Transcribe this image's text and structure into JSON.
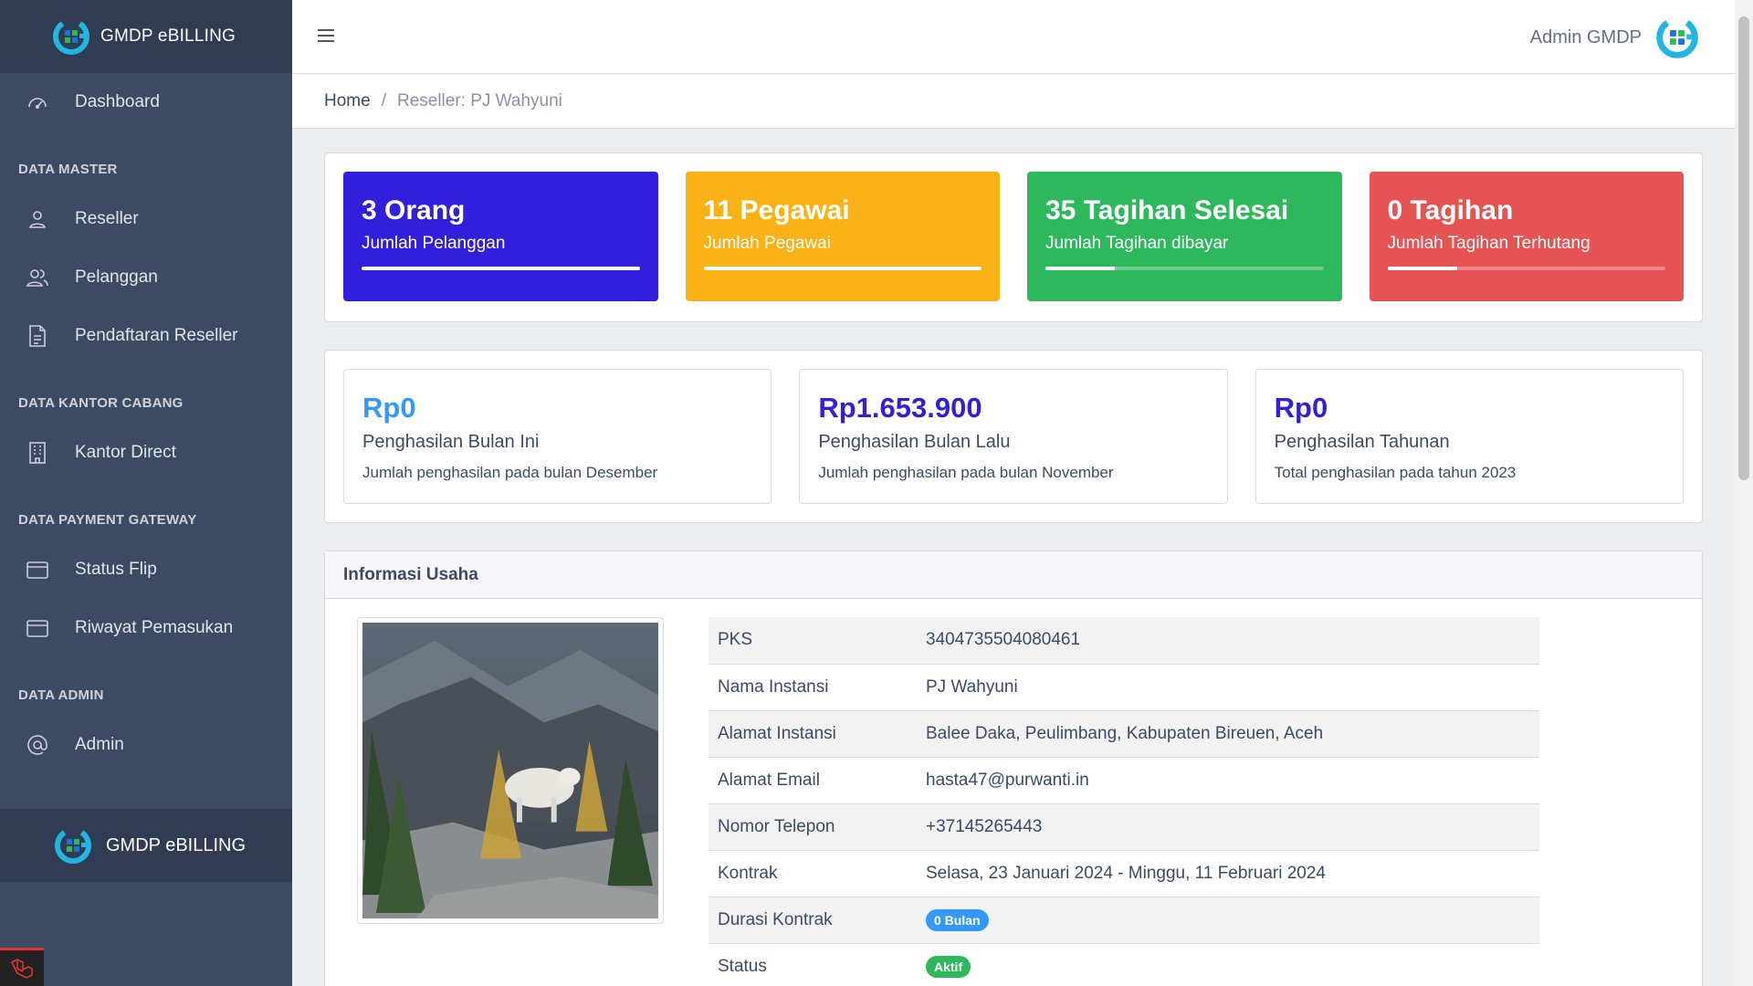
{
  "app": {
    "brand": "GMDP eBILLING"
  },
  "sidebar": {
    "dashboard": "Dashboard",
    "sections": [
      {
        "title": "DATA MASTER",
        "items": [
          "Reseller",
          "Pelanggan",
          "Pendaftaran Reseller"
        ]
      },
      {
        "title": "DATA KANTOR CABANG",
        "items": [
          "Kantor Direct"
        ]
      },
      {
        "title": "DATA PAYMENT GATEWAY",
        "items": [
          "Status Flip",
          "Riwayat Pemasukan"
        ]
      },
      {
        "title": "DATA ADMIN",
        "items": [
          "Admin"
        ]
      }
    ],
    "footer": "GMDP eBILLING"
  },
  "header": {
    "user_name": "Admin GMDP"
  },
  "breadcrumb": {
    "home": "Home",
    "separator": "/",
    "active": "Reseller: PJ Wahyuni"
  },
  "stats": [
    {
      "big": "3 Orang",
      "small": "Jumlah Pelanggan",
      "progress": 1.0,
      "color": "#321fdb"
    },
    {
      "big": "11 Pegawai",
      "small": "Jumlah Pegawai",
      "progress": 1.0,
      "color": "#f9b115"
    },
    {
      "big": "35 Tagihan Selesai",
      "small": "Jumlah Tagihan dibayar",
      "progress": 0.25,
      "color": "#2eb85c"
    },
    {
      "big": "0 Tagihan",
      "small": "Jumlah Tagihan Terhutang",
      "progress": 0.25,
      "color": "#e55353"
    }
  ],
  "income": [
    {
      "amount": "Rp0",
      "label": "Penghasilan Bulan Ini",
      "desc": "Jumlah penghasilan pada bulan Desember",
      "color": "#39f"
    },
    {
      "amount": "Rp1.653.900",
      "label": "Penghasilan Bulan Lalu",
      "desc": "Jumlah penghasilan pada bulan November",
      "color": "#321fdb"
    },
    {
      "amount": "Rp0",
      "label": "Penghasilan Tahunan",
      "desc": "Total penghasilan pada tahun 2023",
      "color": "#321fdb"
    }
  ],
  "info": {
    "title": "Informasi Usaha",
    "rows": [
      {
        "key": "PKS",
        "value": "3404735504080461"
      },
      {
        "key": "Nama Instansi",
        "value": "PJ Wahyuni"
      },
      {
        "key": "Alamat Instansi",
        "value": "Balee Daka, Peulimbang, Kabupaten Bireuen, Aceh"
      },
      {
        "key": "Alamat Email",
        "value": "hasta47@purwanti.in"
      },
      {
        "key": "Nomor Telepon",
        "value": "+37145265443"
      },
      {
        "key": "Kontrak",
        "value": "Selasa, 23 Januari 2024 - Minggu, 11 Februari 2024"
      }
    ],
    "durasi": {
      "key": "Durasi Kontrak",
      "badge": "0 Bulan"
    },
    "status": {
      "key": "Status",
      "badge": "Aktif"
    }
  }
}
